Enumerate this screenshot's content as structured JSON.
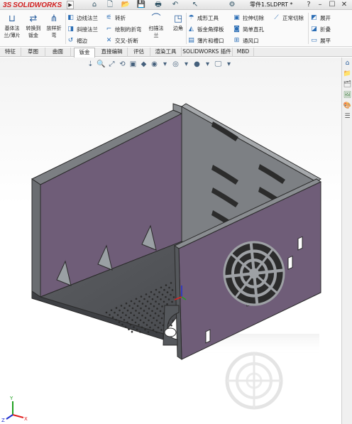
{
  "app": {
    "logo_ds": "3S",
    "logo_text": "SOLIDWORKS",
    "doc_title": "零件1.SLDPRT *"
  },
  "quick_access": [
    "⌂",
    "🗋",
    "📂",
    "💾",
    "🖶",
    "↶",
    "↖",
    "⚙"
  ],
  "window_controls": [
    "?",
    "–",
    "☐",
    "✕"
  ],
  "ribbon": {
    "big_buttons": [
      {
        "label1": "基体法",
        "label2": "兰/薄片",
        "icon": "⊔"
      },
      {
        "label1": "转换到",
        "label2": "钣金",
        "icon": "⇄"
      },
      {
        "label1": "放样折",
        "label2": "弯",
        "icon": "⋔"
      },
      {
        "label1": "扫描法",
        "label2": "兰",
        "icon": "⌒"
      },
      {
        "label1": "边角",
        "label2": "",
        "icon": "◳"
      }
    ],
    "col1": [
      "边线法兰",
      "斜接法兰",
      "褶边"
    ],
    "col2": [
      "转折",
      "绘制的折弯",
      "交叉-折断"
    ],
    "col3": [
      "成形工具",
      "钣金角撑板",
      "薄片和槽口"
    ],
    "col4": [
      "拉伸切除",
      "简单直孔",
      "通风口"
    ],
    "col5": [
      "正常切除"
    ],
    "col6": [
      "展开",
      "折叠",
      "展平"
    ]
  },
  "tabs": [
    {
      "label": "特征",
      "active": false
    },
    {
      "label": "草图",
      "active": false
    },
    {
      "label": "曲面",
      "active": false
    },
    {
      "label": "钣金",
      "active": true
    },
    {
      "label": "直接编辑",
      "active": false
    },
    {
      "label": "评估",
      "active": false
    },
    {
      "label": "渲染工具",
      "active": false
    },
    {
      "label": "SOLIDWORKS 插件",
      "active": false
    },
    {
      "label": "MBD",
      "active": false
    }
  ],
  "heads_up": [
    "⇣",
    "🔍",
    "⤢",
    "⟲",
    "▣",
    "◆",
    "◉",
    "▾",
    "◎",
    "▾",
    "●",
    "▾",
    "🖵",
    "▾"
  ],
  "task_pane": [
    "⌂",
    "📁",
    "🗂",
    "🖼",
    "🎨",
    "☰"
  ],
  "colors": {
    "panel_dark": "#56585c",
    "panel_mid": "#7a7d80",
    "panel_inner": "#6f5d78",
    "perforation": "#2b2b2b",
    "triad_x": "#e02020",
    "triad_y": "#20a020",
    "triad_z": "#2030d0"
  },
  "triad": {
    "x": "X",
    "y": "Y",
    "z": "Z"
  }
}
